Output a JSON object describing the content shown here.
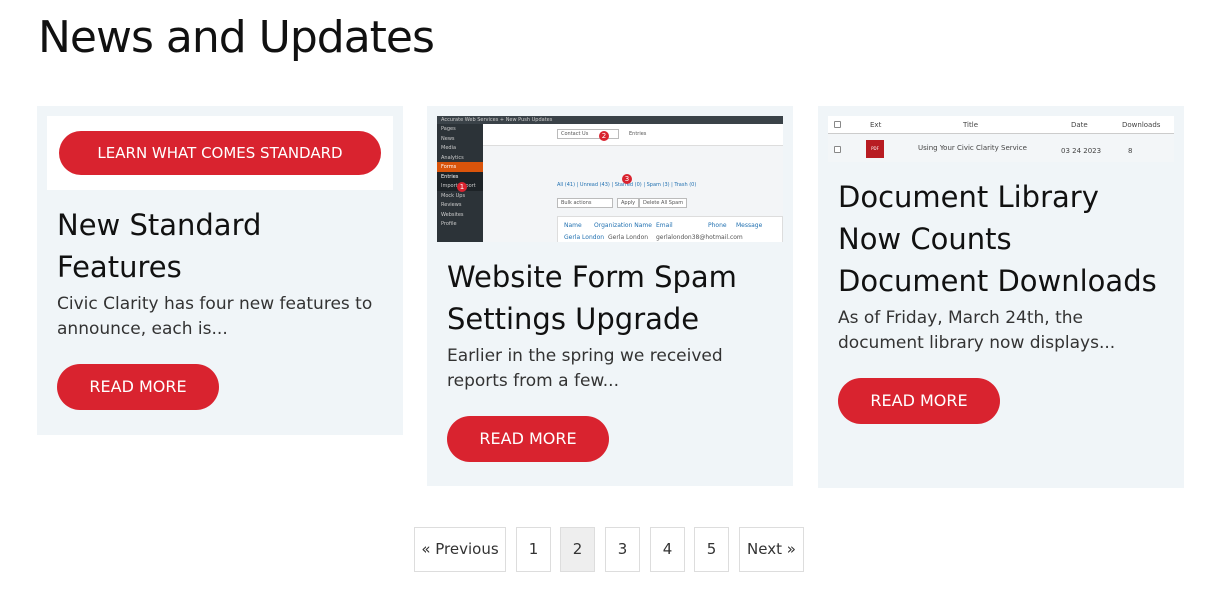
{
  "page": {
    "title": "News and Updates"
  },
  "colors": {
    "accent": "#d9232f",
    "card_bg": "#f0f5f8"
  },
  "cards": [
    {
      "image_text": "LEARN WHAT COMES STANDARD",
      "title": "New Standard Features",
      "excerpt": "Civic Clarity has four new features to announce, each is...",
      "button": "READ MORE"
    },
    {
      "image_text": {
        "topbar": "Accurate Web Services   + New   Push Updates",
        "sidebar": [
          "Pages",
          "News",
          "Media",
          "Analytics",
          "Forms",
          "Entries",
          "Import/Export",
          "Mock Ups",
          "Reviews",
          "Websites",
          "Profile"
        ],
        "form_select": "Contact Us",
        "tab": "Entries",
        "filters": "All (41) | Unread (43) | Starred (0) | Spam (3) | Trash (0)",
        "bulk": "Bulk actions",
        "apply": "Apply",
        "delete_spam": "Delete All Spam",
        "cols": [
          "Name",
          "Organization Name",
          "Email",
          "Phone",
          "Message"
        ],
        "row": [
          "Gerla London",
          "Gerla London",
          "gerlalondon38@hotmail.com"
        ],
        "markers": [
          "1",
          "2",
          "3"
        ]
      },
      "title": "Website Form Spam Settings Upgrade",
      "excerpt": "Earlier in the spring we received reports from a few...",
      "button": "READ MORE"
    },
    {
      "image_text": {
        "cols": [
          "Ext",
          "Title",
          "Date",
          "Downloads"
        ],
        "row": {
          "ext": "PDF",
          "title": "Using Your Civic Clarity Service",
          "date": "03 24 2023",
          "downloads": "8"
        }
      },
      "title": "Document Library Now Counts Document Downloads",
      "excerpt": "As of Friday, March 24th, the document library now displays...",
      "button": "READ MORE"
    }
  ],
  "pagination": {
    "previous": "« Previous",
    "pages": [
      "1",
      "2",
      "3",
      "4",
      "5"
    ],
    "current": "2",
    "next": "Next »"
  }
}
